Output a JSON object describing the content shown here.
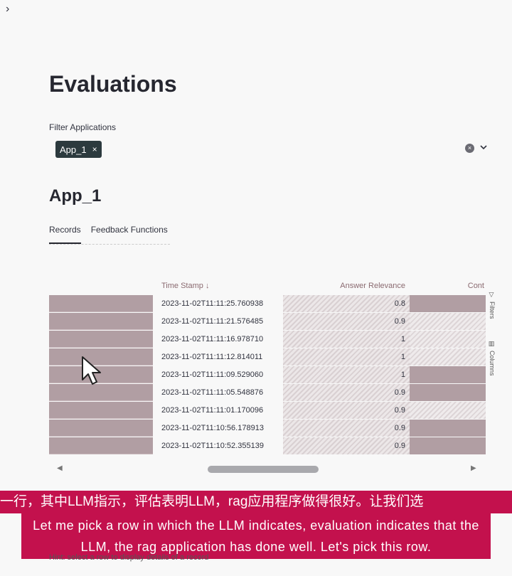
{
  "nav": {
    "expand_chevron": "›"
  },
  "page": {
    "title": "Evaluations"
  },
  "filter": {
    "label": "Filter Applications",
    "selected_tag": "App_1",
    "tag_close": "×",
    "clear_glyph": "×",
    "dropdown_glyph": "⌄"
  },
  "app": {
    "title": "App_1",
    "tabs": [
      {
        "label": "Records"
      },
      {
        "label": "Feedback Functions"
      }
    ]
  },
  "grid": {
    "headers": {
      "timestamp": "Time Stamp ↓",
      "answer_relevance": "Answer Relevance",
      "cont": "Cont"
    },
    "rows": [
      {
        "timestamp": "2023-11-02T11:11:25.760938",
        "answer_relevance": "0.8",
        "cont_style": "pink"
      },
      {
        "timestamp": "2023-11-02T11:11:21.576485",
        "answer_relevance": "0.9",
        "cont_style": "hatch"
      },
      {
        "timestamp": "2023-11-02T11:11:16.978710",
        "answer_relevance": "1",
        "cont_style": "hatch"
      },
      {
        "timestamp": "2023-11-02T11:11:12.814011",
        "answer_relevance": "1",
        "cont_style": "hatch"
      },
      {
        "timestamp": "2023-11-02T11:11:09.529060",
        "answer_relevance": "1",
        "cont_style": "pink"
      },
      {
        "timestamp": "2023-11-02T11:11:05.548876",
        "answer_relevance": "0.9",
        "cont_style": "pink"
      },
      {
        "timestamp": "2023-11-02T11:11:01.170096",
        "answer_relevance": "0.9",
        "cont_style": "hatch"
      },
      {
        "timestamp": "2023-11-02T11:10:56.178913",
        "answer_relevance": "0.9",
        "cont_style": "pink"
      },
      {
        "timestamp": "2023-11-02T11:10:52.355139",
        "answer_relevance": "0.9",
        "cont_style": "pink"
      }
    ],
    "side_tools": {
      "filters": "Filters",
      "columns": "Columns"
    },
    "scroll": {
      "left": "◀",
      "right": "▶"
    }
  },
  "subtitles": {
    "zh": "一行，其中LLM指示，评估表明LLM，rag应用程序做得很好。让我们选",
    "en": "Let me pick a row in which the LLM indicates, evaluation indicates that the LLM, the rag application has done well. Let's pick this row."
  },
  "hint": "Hint: select a row to display details of a record",
  "colors": {
    "accent": "#c3114d",
    "row_fill": "#b19ea3",
    "tag_bg": "#2c3a3e"
  },
  "icons": [
    "chevron-right-icon",
    "close-icon",
    "clear-icon",
    "chevron-down-icon",
    "sort-arrow-icon",
    "filter-icon",
    "columns-icon",
    "mouse-pointer-icon"
  ]
}
